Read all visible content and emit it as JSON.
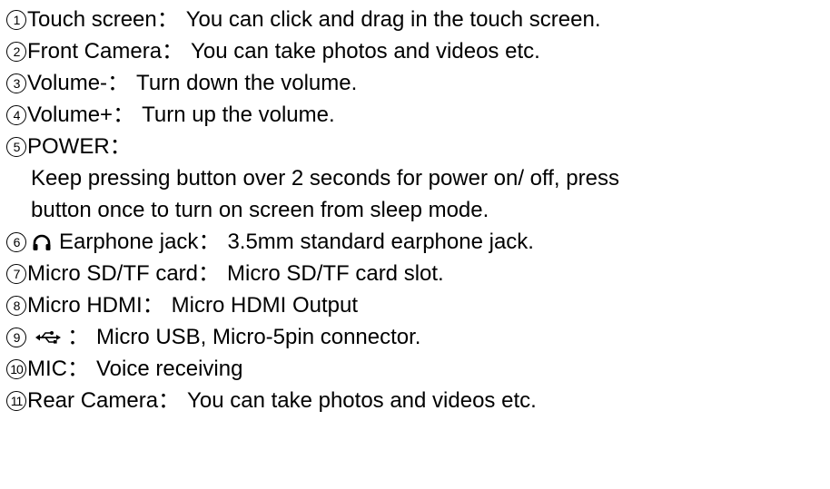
{
  "items": [
    {
      "num": "1",
      "label": "Touch screen",
      "sep": "：",
      "desc": "You can click and drag in the touch screen."
    },
    {
      "num": "2",
      "label": "Front Camera",
      "sep": "：",
      "desc": "You can take photos and videos etc."
    },
    {
      "num": "3",
      "label": "Volume-",
      "sep": "：",
      "desc": "Turn down the volume."
    },
    {
      "num": "4",
      "label": "Volume+",
      "sep": "：",
      "desc": "Turn up the volume."
    },
    {
      "num": "5",
      "label": "POWER",
      "sep": "："
    },
    {
      "num": "6",
      "icon": "headphones-icon",
      "label": "Earphone jack",
      "sep": "：",
      "desc": "3.5mm standard earphone jack."
    },
    {
      "num": "7",
      "label": "Micro SD/TF card",
      "sep": "：",
      "desc": "Micro SD/TF card slot."
    },
    {
      "num": "8",
      "label": "Micro HDMI",
      "sep": "：",
      "desc": "Micro HDMI Output"
    },
    {
      "num": "9",
      "icon": "usb-icon",
      "sep": "：",
      "desc": "Micro USB, Micro-5pin connector."
    },
    {
      "num": "10",
      "label": "MIC",
      "sep": "：",
      "desc": "Voice receiving"
    },
    {
      "num": "11",
      "label": "Rear Camera",
      "sep": "：",
      "desc": "You can take photos and videos etc."
    }
  ],
  "power_desc_line1": "Keep pressing button over 2 seconds for power on/ off, press",
  "power_desc_line2": "button once to turn on screen from sleep mode."
}
